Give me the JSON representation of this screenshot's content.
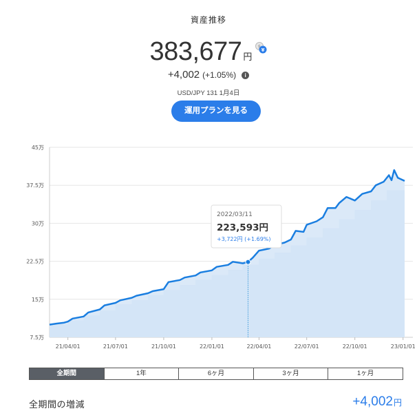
{
  "header": {
    "title": "資産推移",
    "total_value": "383,677",
    "unit": "円",
    "change_value": "+4,002",
    "change_pct": "(+1.05%)",
    "fx_rate": "USD/JPY 131 1月4日",
    "plan_button": "運用プランを見る"
  },
  "tooltip": {
    "date": "2022/03/11",
    "value": "223,593円",
    "change": "+3,722円 (+1.69%)"
  },
  "tabs": [
    {
      "label": "全期間",
      "active": true
    },
    {
      "label": "1年",
      "active": false
    },
    {
      "label": "6ヶ月",
      "active": false
    },
    {
      "label": "3ヶ月",
      "active": false
    },
    {
      "label": "1ヶ月",
      "active": false
    }
  ],
  "summary": {
    "label": "全期間の増減",
    "value": "+4,002",
    "unit": "円"
  },
  "colors": {
    "accent": "#2b7de9",
    "line": "#1a7ee0",
    "fill": "#dbe9f8",
    "step_fill": "#b7d5f5"
  },
  "chart_data": {
    "type": "area",
    "x_unit": "date",
    "y_tick_labels": [
      "7.5万",
      "15万",
      "22.5万",
      "30万",
      "37.5万",
      "45万"
    ],
    "y_ticks": [
      75000,
      150000,
      225000,
      300000,
      375000,
      450000
    ],
    "ylim": [
      75000,
      450000
    ],
    "x_tick_labels": [
      "21/04/01",
      "21/07/01",
      "21/10/01",
      "22/01/01",
      "22/04/01",
      "22/07/01",
      "22/10/01",
      "23/01/01"
    ],
    "x_ticks": [
      "2021-04-01",
      "2021-07-01",
      "2021-10-01",
      "2022-01-01",
      "2022-04-01",
      "2022-07-01",
      "2022-10-01",
      "2023-01-01"
    ],
    "xlim": [
      "2021-02-25",
      "2023-01-04"
    ],
    "grid": true,
    "series": [
      {
        "kind": "value",
        "points": [
          [
            "2021-02-25",
            100000
          ],
          [
            "2021-03-10",
            102000
          ],
          [
            "2021-03-25",
            104000
          ],
          [
            "2021-04-01",
            106000
          ],
          [
            "2021-04-10",
            112000
          ],
          [
            "2021-05-01",
            116000
          ],
          [
            "2021-05-10",
            124000
          ],
          [
            "2021-06-01",
            130000
          ],
          [
            "2021-06-10",
            138000
          ],
          [
            "2021-07-01",
            143000
          ],
          [
            "2021-07-10",
            148000
          ],
          [
            "2021-08-01",
            153000
          ],
          [
            "2021-08-10",
            157000
          ],
          [
            "2021-09-01",
            162000
          ],
          [
            "2021-09-10",
            166000
          ],
          [
            "2021-10-01",
            170000
          ],
          [
            "2021-10-10",
            184000
          ],
          [
            "2021-11-01",
            188000
          ],
          [
            "2021-11-10",
            193000
          ],
          [
            "2021-12-01",
            197000
          ],
          [
            "2021-12-10",
            203000
          ],
          [
            "2022-01-01",
            207000
          ],
          [
            "2022-01-10",
            214000
          ],
          [
            "2022-02-01",
            218000
          ],
          [
            "2022-02-10",
            224000
          ],
          [
            "2022-03-01",
            221000
          ],
          [
            "2022-03-11",
            223593
          ],
          [
            "2022-03-20",
            232000
          ],
          [
            "2022-04-01",
            246000
          ],
          [
            "2022-04-20",
            250000
          ],
          [
            "2022-05-01",
            257000
          ],
          [
            "2022-05-20",
            262000
          ],
          [
            "2022-06-01",
            268000
          ],
          [
            "2022-06-10",
            285000
          ],
          [
            "2022-06-25",
            283000
          ],
          [
            "2022-07-01",
            297000
          ],
          [
            "2022-07-20",
            304000
          ],
          [
            "2022-08-01",
            312000
          ],
          [
            "2022-08-10",
            330000
          ],
          [
            "2022-08-25",
            330000
          ],
          [
            "2022-09-01",
            340000
          ],
          [
            "2022-09-15",
            352000
          ],
          [
            "2022-10-01",
            345000
          ],
          [
            "2022-10-15",
            358000
          ],
          [
            "2022-11-01",
            363000
          ],
          [
            "2022-11-10",
            375000
          ],
          [
            "2022-11-25",
            382000
          ],
          [
            "2022-12-05",
            395000
          ],
          [
            "2022-12-10",
            385000
          ],
          [
            "2022-12-15",
            405000
          ],
          [
            "2022-12-22",
            390000
          ],
          [
            "2022-12-28",
            387000
          ],
          [
            "2023-01-04",
            383677
          ]
        ]
      },
      {
        "kind": "principal",
        "points": [
          [
            "2021-02-25",
            100000
          ],
          [
            "2021-04-01",
            100000
          ],
          [
            "2021-04-01",
            108000
          ],
          [
            "2021-05-01",
            108000
          ],
          [
            "2021-05-01",
            118000
          ],
          [
            "2021-06-01",
            118000
          ],
          [
            "2021-06-01",
            128000
          ],
          [
            "2021-07-01",
            128000
          ],
          [
            "2021-07-01",
            140000
          ],
          [
            "2021-08-01",
            140000
          ],
          [
            "2021-08-01",
            148000
          ],
          [
            "2021-09-01",
            148000
          ],
          [
            "2021-09-01",
            158000
          ],
          [
            "2021-10-01",
            158000
          ],
          [
            "2021-10-01",
            168000
          ],
          [
            "2021-11-01",
            168000
          ],
          [
            "2021-11-01",
            178000
          ],
          [
            "2021-12-01",
            178000
          ],
          [
            "2021-12-01",
            188000
          ],
          [
            "2022-01-01",
            188000
          ],
          [
            "2022-01-01",
            198000
          ],
          [
            "2022-02-01",
            198000
          ],
          [
            "2022-02-01",
            208000
          ],
          [
            "2022-03-01",
            208000
          ],
          [
            "2022-03-01",
            218000
          ],
          [
            "2022-04-01",
            218000
          ],
          [
            "2022-04-01",
            230000
          ],
          [
            "2022-05-01",
            230000
          ],
          [
            "2022-05-01",
            242000
          ],
          [
            "2022-06-01",
            242000
          ],
          [
            "2022-06-01",
            256000
          ],
          [
            "2022-07-01",
            256000
          ],
          [
            "2022-07-01",
            272000
          ],
          [
            "2022-08-01",
            272000
          ],
          [
            "2022-08-01",
            290000
          ],
          [
            "2022-09-01",
            290000
          ],
          [
            "2022-09-01",
            308000
          ],
          [
            "2022-10-01",
            308000
          ],
          [
            "2022-10-01",
            326000
          ],
          [
            "2022-11-01",
            326000
          ],
          [
            "2022-11-01",
            345000
          ],
          [
            "2022-12-01",
            345000
          ],
          [
            "2022-12-01",
            365000
          ],
          [
            "2023-01-04",
            365000
          ]
        ]
      }
    ],
    "highlight": {
      "x": "2022-03-11",
      "y": 223593
    }
  }
}
